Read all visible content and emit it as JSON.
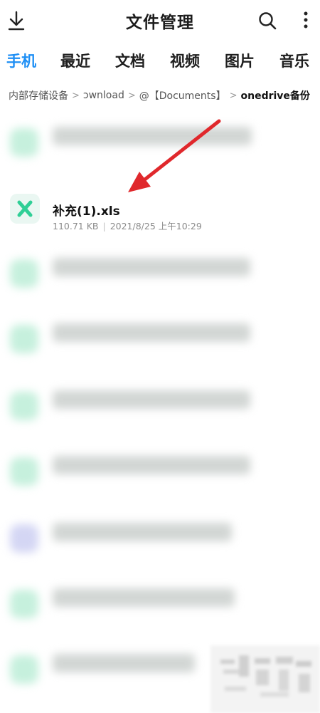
{
  "header": {
    "title": "文件管理",
    "download_icon": "download-icon",
    "search_icon": "search-icon",
    "more_icon": "more-vertical-icon"
  },
  "tabs": [
    {
      "label": "手机",
      "active": true
    },
    {
      "label": "最近",
      "active": false
    },
    {
      "label": "文档",
      "active": false
    },
    {
      "label": "视频",
      "active": false
    },
    {
      "label": "图片",
      "active": false
    },
    {
      "label": "音乐",
      "active": false
    }
  ],
  "breadcrumb": {
    "items": [
      "内部存储设备",
      "ɔwnload",
      "@【Documents】",
      "onedrive备份"
    ],
    "separator": ">"
  },
  "files": {
    "highlighted": {
      "name": "补充(1).xls",
      "size": "110.71 KB",
      "date": "2021/8/25 上午10:29",
      "meta_separator": "|",
      "icon": "excel-x-icon"
    }
  },
  "colors": {
    "accent": "#1e8ff5",
    "excel_green": "#2fcf96",
    "arrow_red": "#e0282c"
  }
}
